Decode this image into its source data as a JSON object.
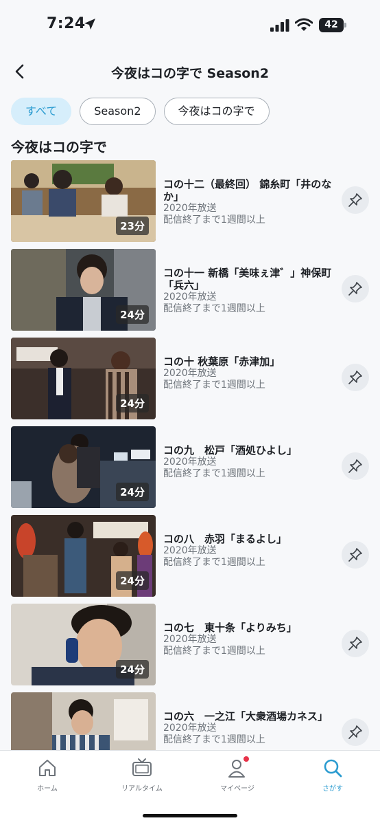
{
  "status": {
    "time": "7:24",
    "battery": "42"
  },
  "header": {
    "title": "今夜はコの字で Season2",
    "back_icon": "chevron-left-icon"
  },
  "filters": [
    {
      "label": "すべて",
      "active": true
    },
    {
      "label": "Season2",
      "active": false
    },
    {
      "label": "今夜はコの字で",
      "active": false
    }
  ],
  "section": {
    "title": "今夜はコの字で"
  },
  "episodes": [
    {
      "title": "コの十二（最終回） 錦糸町「井のなか」",
      "year": "2020年放送",
      "availability": "配信終了まで1週間以上",
      "duration": "23分"
    },
    {
      "title": "コの十一 新橋「美味ぇ津゛」神保町「兵六」",
      "year": "2020年放送",
      "availability": "配信終了まで1週間以上",
      "duration": "24分"
    },
    {
      "title": "コの十 秋葉原「赤津加」",
      "year": "2020年放送",
      "availability": "配信終了まで1週間以上",
      "duration": "24分"
    },
    {
      "title": "コの九　松戸「酒処ひよし」",
      "year": "2020年放送",
      "availability": "配信終了まで1週間以上",
      "duration": "24分"
    },
    {
      "title": "コの八　赤羽「まるよし」",
      "year": "2020年放送",
      "availability": "配信終了まで1週間以上",
      "duration": "24分"
    },
    {
      "title": "コの七　東十条「よりみち」",
      "year": "2020年放送",
      "availability": "配信終了まで1週間以上",
      "duration": "24分"
    },
    {
      "title": "コの六　一之江「大衆酒場カネス」",
      "year": "2020年放送",
      "availability": "配信終了まで1週間以上",
      "duration": ""
    }
  ],
  "tabs": [
    {
      "label": "ホーム",
      "icon": "home-icon"
    },
    {
      "label": "リアルタイム",
      "icon": "tv-icon"
    },
    {
      "label": "マイページ",
      "icon": "user-icon"
    },
    {
      "label": "さがす",
      "icon": "search-icon"
    }
  ],
  "colors": {
    "accent": "#2a9bd0",
    "chip_active_bg": "#d6eefb",
    "badge": "#e8334a"
  }
}
